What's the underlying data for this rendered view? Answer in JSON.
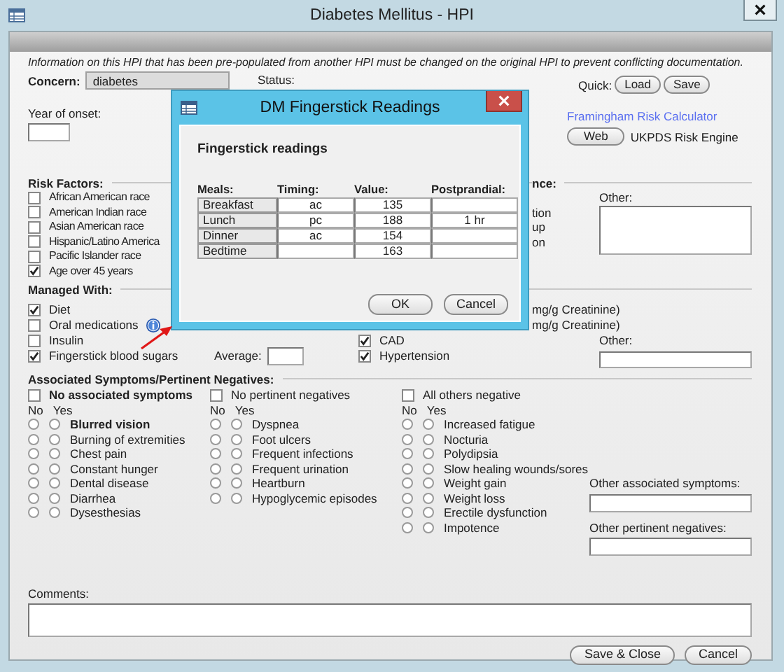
{
  "window": {
    "title": "Diabetes Mellitus - HPI"
  },
  "notice": "Information on this HPI that has been pre-populated from another HPI must be changed on the original HPI to prevent conflicting documentation.",
  "concern": {
    "label": "Concern:",
    "value": "diabetes"
  },
  "status": {
    "label": "Status:"
  },
  "quick": {
    "label": "Quick:",
    "buttons": [
      "Load",
      "Save"
    ]
  },
  "year_of_onset": {
    "label": "Year of onset:"
  },
  "risk_tools": {
    "link": "Framingham Risk Calculator",
    "button": "Web",
    "caption": "UKPDS Risk Engine"
  },
  "risk_factors": {
    "heading": "Risk Factors:",
    "items": [
      {
        "label": "African American race",
        "checked": false
      },
      {
        "label": "American Indian race",
        "checked": false
      },
      {
        "label": "Asian American race",
        "checked": false
      },
      {
        "label": "Hispanic/Latino America",
        "checked": false
      },
      {
        "label": "Pacific Islander race",
        "checked": false
      },
      {
        "label": "Age over 45 years",
        "checked": true
      }
    ]
  },
  "partial_section": {
    "heading": "nce:",
    "items": [
      "tion",
      "up",
      "on"
    ],
    "other_label": "Other:"
  },
  "managed_with": {
    "heading": "Managed With:",
    "items": [
      {
        "label": "Diet",
        "checked": true,
        "info": false
      },
      {
        "label": "Oral medications",
        "checked": false,
        "info": true
      },
      {
        "label": "Insulin",
        "checked": false,
        "info": false
      },
      {
        "label": "Fingerstick blood sugars",
        "checked": true,
        "info": false
      }
    ],
    "average_label": "Average:",
    "creatinine_lines": [
      "mg/g Creatinine)",
      "mg/g Creatinine)"
    ],
    "conditions": [
      {
        "label": "CAD",
        "checked": true
      },
      {
        "label": "Hypertension",
        "checked": true
      }
    ],
    "other_label": "Other:"
  },
  "symptoms": {
    "heading": "Associated Symptoms/Pertinent Negatives:",
    "columns": [
      {
        "toggle": {
          "label": "No associated symptoms",
          "checked": false,
          "bold": true
        },
        "no_label": "No",
        "yes_label": "Yes",
        "items": [
          {
            "label": "Blurred vision",
            "bold": true,
            "no": false,
            "yes": false
          },
          {
            "label": "Burning of extremities",
            "bold": false,
            "no": false,
            "yes": false
          },
          {
            "label": "Chest pain",
            "bold": false,
            "no": false,
            "yes": false
          },
          {
            "label": "Constant hunger",
            "bold": false,
            "no": false,
            "yes": false
          },
          {
            "label": "Dental disease",
            "bold": false,
            "no": false,
            "yes": false
          },
          {
            "label": "Diarrhea",
            "bold": false,
            "no": false,
            "yes": false
          },
          {
            "label": "Dysesthesias",
            "bold": false,
            "no": false,
            "yes": false
          }
        ]
      },
      {
        "toggle": {
          "label": "No pertinent negatives",
          "checked": false,
          "bold": false
        },
        "no_label": "No",
        "yes_label": "Yes",
        "items": [
          {
            "label": "Dyspnea",
            "bold": false,
            "no": false,
            "yes": false
          },
          {
            "label": "Foot ulcers",
            "bold": false,
            "no": false,
            "yes": false
          },
          {
            "label": "Frequent infections",
            "bold": false,
            "no": false,
            "yes": false
          },
          {
            "label": "Frequent urination",
            "bold": false,
            "no": false,
            "yes": false
          },
          {
            "label": "Heartburn",
            "bold": false,
            "no": false,
            "yes": false
          },
          {
            "label": "Hypoglycemic episodes",
            "bold": false,
            "no": false,
            "yes": false
          }
        ]
      },
      {
        "toggle": {
          "label": "All others negative",
          "checked": false,
          "bold": false
        },
        "no_label": "No",
        "yes_label": "Yes",
        "items": [
          {
            "label": "Increased fatigue",
            "bold": false,
            "no": false,
            "yes": false
          },
          {
            "label": "Nocturia",
            "bold": false,
            "no": false,
            "yes": false
          },
          {
            "label": "Polydipsia",
            "bold": false,
            "no": false,
            "yes": false
          },
          {
            "label": "Slow healing wounds/sores",
            "bold": false,
            "no": false,
            "yes": false
          },
          {
            "label": "Weight gain",
            "bold": false,
            "no": false,
            "yes": false
          },
          {
            "label": "Weight loss",
            "bold": false,
            "no": false,
            "yes": false
          },
          {
            "label": "Erectile dysfunction",
            "bold": false,
            "no": false,
            "yes": false
          },
          {
            "label": "Impotence",
            "bold": false,
            "no": false,
            "yes": false
          }
        ]
      }
    ],
    "other_associated_label": "Other associated symptoms:",
    "other_negatives_label": "Other pertinent negatives:"
  },
  "comments": {
    "label": "Comments:"
  },
  "footer_buttons": [
    "Save & Close",
    "Cancel"
  ],
  "dialog": {
    "title": "DM Fingerstick Readings",
    "heading": "Fingerstick readings",
    "columns": [
      "Meals:",
      "Timing:",
      "Value:",
      "Postprandial:"
    ],
    "rows": [
      {
        "meal": "Breakfast",
        "timing": "ac",
        "value": "135"
      },
      {
        "meal": "Lunch",
        "timing": "pc",
        "value": "188",
        "postprandial": "1 hr"
      },
      {
        "meal": "Dinner",
        "timing": "ac",
        "value": "154"
      },
      {
        "meal": "Bedtime",
        "value": "163"
      }
    ],
    "buttons": [
      "OK",
      "Cancel"
    ]
  }
}
